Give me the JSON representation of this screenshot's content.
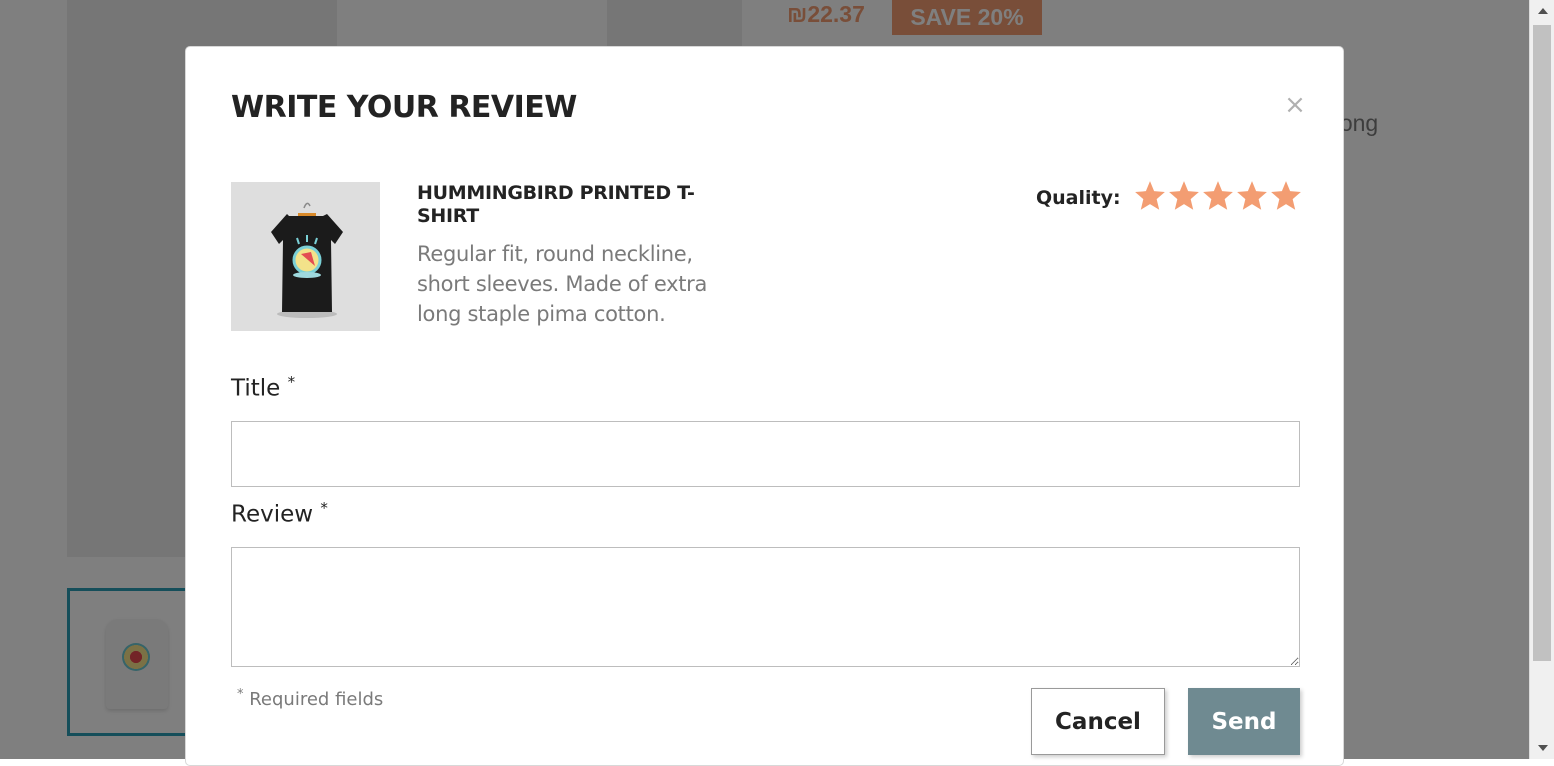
{
  "background": {
    "price": "₪22.37",
    "discount_badge": "SAVE 20%",
    "description_fragment": "xtra long"
  },
  "modal": {
    "title": "WRITE YOUR REVIEW",
    "close_symbol": "×",
    "product": {
      "name": "HUMMINGBIRD PRINTED T-SHIRT",
      "description": "Regular fit, round neckline, short sleeves. Made of extra long staple pima cotton."
    },
    "quality": {
      "label": "Quality:",
      "rating": 5,
      "max_rating": 5,
      "star_color": "#f39d72"
    },
    "form": {
      "title_label": "Title",
      "title_value": "",
      "review_label": "Review",
      "review_value": "",
      "required_marker": "*",
      "required_note": "Required fields"
    },
    "buttons": {
      "cancel": "Cancel",
      "send": "Send"
    }
  },
  "colors": {
    "accent": "#2a9db4",
    "price": "#f39d72",
    "send_button": "#6f8a91"
  }
}
